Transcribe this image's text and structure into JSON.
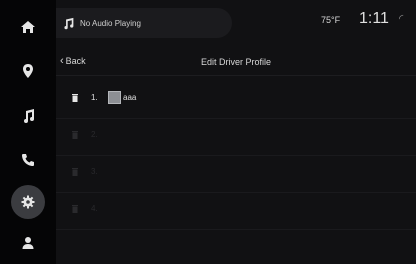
{
  "status": {
    "audio": "No Audio Playing",
    "temperature": "75°F",
    "time": "1:11"
  },
  "sidebar": {
    "items": [
      {
        "icon": "home-icon"
      },
      {
        "icon": "location-icon"
      },
      {
        "icon": "music-icon"
      },
      {
        "icon": "phone-icon"
      },
      {
        "icon": "settings-icon",
        "active": true
      },
      {
        "icon": "profile-icon"
      }
    ]
  },
  "header": {
    "back_label": "Back",
    "title": "Edit Driver Profile"
  },
  "profiles": [
    {
      "number": "1.",
      "name": "aaa",
      "enabled": true
    },
    {
      "number": "2.",
      "name": "",
      "enabled": false
    },
    {
      "number": "3.",
      "name": "",
      "enabled": false
    },
    {
      "number": "4.",
      "name": "",
      "enabled": false
    }
  ],
  "colors": {
    "background": "#111113",
    "sidebar": "#050506",
    "active_button": "#3b3c40"
  }
}
